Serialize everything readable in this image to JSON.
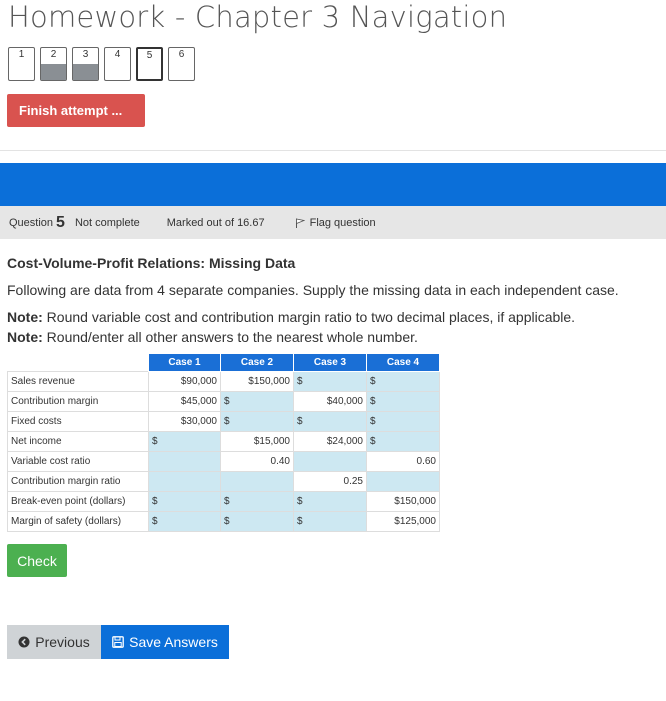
{
  "page": {
    "title": "Homework - Chapter 3 Navigation"
  },
  "quiz_nav": {
    "buttons": [
      {
        "label": "1",
        "answered": false,
        "current": false
      },
      {
        "label": "2",
        "answered": true,
        "current": false
      },
      {
        "label": "3",
        "answered": true,
        "current": false
      },
      {
        "label": "4",
        "answered": false,
        "current": false
      },
      {
        "label": "5",
        "answered": false,
        "current": true
      },
      {
        "label": "6",
        "answered": false,
        "current": false
      }
    ],
    "finish_label": "Finish attempt ..."
  },
  "question_info": {
    "question_word": "Question",
    "number": "5",
    "state": "Not complete",
    "marked": "Marked out of 16.67",
    "flag_label": "Flag question"
  },
  "question": {
    "title": "Cost-Volume-Profit Relations: Missing Data",
    "text": "Following are data from 4 separate companies. Supply the missing data in each independent case.",
    "note1_bold": "Note:",
    "note1_text": " Round variable cost and contribution margin ratio to two decimal places, if applicable.",
    "note2_bold": "Note:",
    "note2_text": " Round/enter all other answers to the nearest whole number."
  },
  "table": {
    "headers": [
      "",
      "Case 1",
      "Case 2",
      "Case 3",
      "Case 4"
    ],
    "rows": [
      {
        "label": "Sales revenue",
        "cells": [
          {
            "type": "value",
            "text": "$90,000"
          },
          {
            "type": "value",
            "text": "$150,000"
          },
          {
            "type": "input",
            "prefix": "$"
          },
          {
            "type": "input",
            "prefix": "$"
          }
        ]
      },
      {
        "label": "Contribution margin",
        "cells": [
          {
            "type": "value",
            "text": "$45,000"
          },
          {
            "type": "input",
            "prefix": "$"
          },
          {
            "type": "value",
            "text": "$40,000"
          },
          {
            "type": "input",
            "prefix": "$"
          }
        ]
      },
      {
        "label": "Fixed costs",
        "cells": [
          {
            "type": "value",
            "text": "$30,000"
          },
          {
            "type": "input",
            "prefix": "$"
          },
          {
            "type": "input",
            "prefix": "$"
          },
          {
            "type": "input",
            "prefix": "$"
          }
        ]
      },
      {
        "label": "Net income",
        "cells": [
          {
            "type": "input",
            "prefix": "$"
          },
          {
            "type": "value",
            "text": "$15,000"
          },
          {
            "type": "value",
            "text": "$24,000"
          },
          {
            "type": "input",
            "prefix": "$"
          }
        ]
      },
      {
        "label": "Variable cost ratio",
        "cells": [
          {
            "type": "input",
            "prefix": ""
          },
          {
            "type": "value",
            "text": "0.40"
          },
          {
            "type": "input",
            "prefix": ""
          },
          {
            "type": "value",
            "text": "0.60"
          }
        ]
      },
      {
        "label": "Contribution margin ratio",
        "cells": [
          {
            "type": "input",
            "prefix": ""
          },
          {
            "type": "input",
            "prefix": ""
          },
          {
            "type": "value",
            "text": "0.25"
          },
          {
            "type": "input",
            "prefix": ""
          }
        ]
      },
      {
        "label": "Break-even point (dollars)",
        "cells": [
          {
            "type": "input",
            "prefix": "$"
          },
          {
            "type": "input",
            "prefix": "$"
          },
          {
            "type": "input",
            "prefix": "$"
          },
          {
            "type": "value",
            "text": "$150,000"
          }
        ]
      },
      {
        "label": "Margin of safety (dollars)",
        "cells": [
          {
            "type": "input",
            "prefix": "$"
          },
          {
            "type": "input",
            "prefix": "$"
          },
          {
            "type": "input",
            "prefix": "$"
          },
          {
            "type": "value",
            "text": "$125,000"
          }
        ]
      }
    ]
  },
  "actions": {
    "check_label": "Check",
    "previous_label": "Previous",
    "save_label": "Save Answers"
  },
  "colors": {
    "finish": "#d9534f",
    "blue": "#0b6fd9",
    "check": "#4cb050",
    "input_bg": "#cde8f2"
  }
}
